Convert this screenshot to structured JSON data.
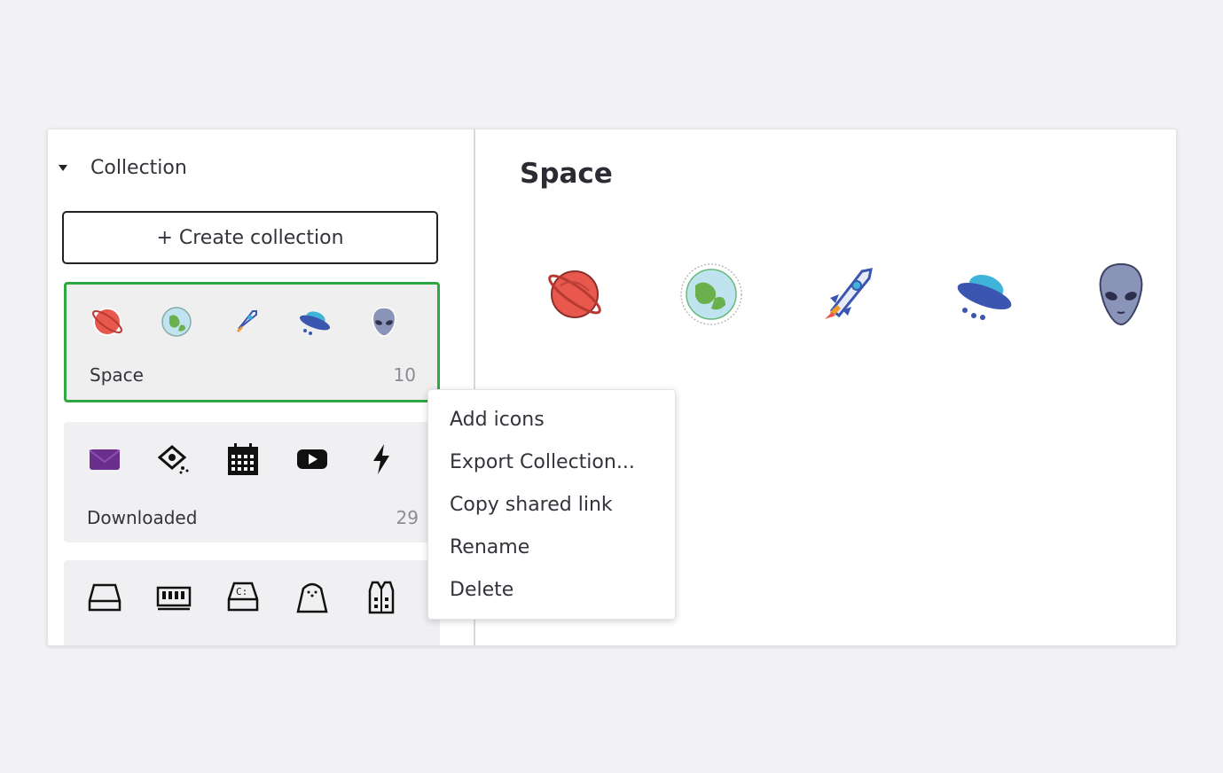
{
  "sidebar": {
    "header": "Collection",
    "create_button": "+ Create collection",
    "collections": [
      {
        "name": "Space",
        "count": "10",
        "icons": [
          "planet-icon",
          "earth-icon",
          "rocket-icon",
          "ufo-icon",
          "alien-icon"
        ]
      },
      {
        "name": "Downloaded",
        "count": "29",
        "icons": [
          "envelope-icon",
          "eye-icon",
          "calendar-icon",
          "youtube-icon",
          "lightning-icon"
        ]
      },
      {
        "name": "",
        "count": "",
        "icons": [
          "hard-drive-icon",
          "ram-icon",
          "disk-c-icon",
          "toaster-icon",
          "vest-icon"
        ]
      }
    ]
  },
  "main": {
    "title": "Space",
    "icons": [
      "planet-icon",
      "earth-icon",
      "rocket-icon",
      "ufo-icon",
      "alien-icon"
    ]
  },
  "context_menu": {
    "items": [
      "Add icons",
      "Export Collection...",
      "Copy shared link",
      "Rename",
      "Delete"
    ]
  },
  "colors": {
    "active_border": "#2ea843",
    "planet": "#e8584d",
    "earth": "#6ab04c",
    "ufo": "#3fb4d8",
    "alien": "#8a93b8",
    "envelope": "#6a2f8c"
  }
}
